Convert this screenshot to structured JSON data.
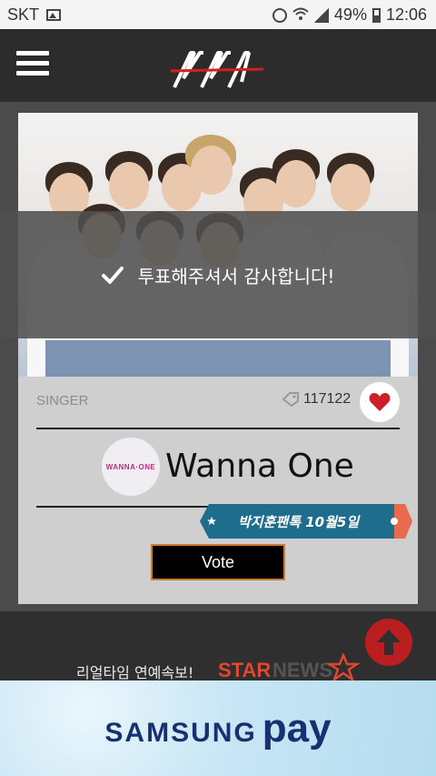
{
  "status_bar": {
    "carrier": "SKT",
    "battery": "49%",
    "time": "12:06"
  },
  "nav": {
    "menu_icon": "hamburger-icon",
    "logo": "logo"
  },
  "card": {
    "category": "SINGER",
    "vote_count": "117122",
    "artist_logo_text": "WANNA·ONE",
    "artist_name": "Wanna One",
    "ribbon_text": "박지훈팬톡 10월5일",
    "vote_label": "Vote"
  },
  "toast": {
    "message": "투표해주셔서 감사합니다!"
  },
  "footer": {
    "realtime_text": "리얼타임 연예속보!",
    "starnews_logo": "STARNEWS"
  },
  "ad": {
    "brand": "SAMSUNG",
    "product": "pay"
  },
  "colors": {
    "accent_red": "#c71d1d",
    "ribbon_blue": "#1e6a8c",
    "ad_text": "#17306f"
  }
}
